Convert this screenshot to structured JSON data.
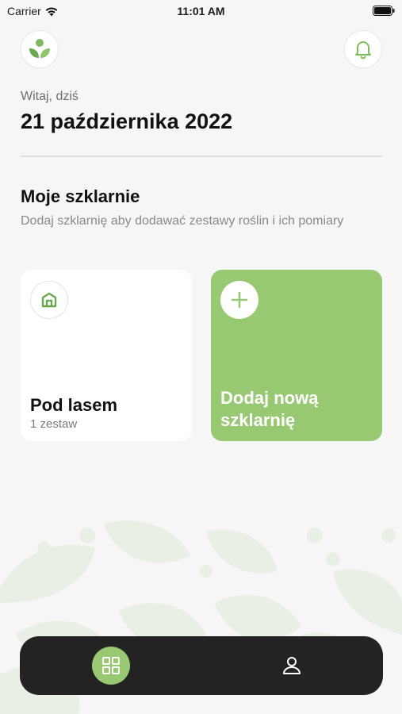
{
  "status_bar": {
    "carrier": "Carrier",
    "time": "11:01 AM"
  },
  "header": {
    "logo_icon": "plant-logo-icon",
    "notification_icon": "bell-icon"
  },
  "greeting": {
    "label": "Witaj, dziś",
    "date": "21 października 2022"
  },
  "greenhouses": {
    "title": "Moje szklarnie",
    "description": "Dodaj szklarnię aby dodawać zestawy roślin i ich pomiary",
    "items": [
      {
        "name": "Pod lasem",
        "count": "1 zestaw",
        "icon": "greenhouse-icon"
      }
    ],
    "add_label": "Dodaj nową szklarnię"
  },
  "tab_bar": {
    "items": [
      {
        "name": "home",
        "icon": "grid-icon",
        "active": true
      },
      {
        "name": "profile",
        "icon": "user-icon",
        "active": false
      }
    ]
  },
  "colors": {
    "accent": "#98c872",
    "background": "#f6f6f6",
    "tab_bar": "#232323"
  }
}
